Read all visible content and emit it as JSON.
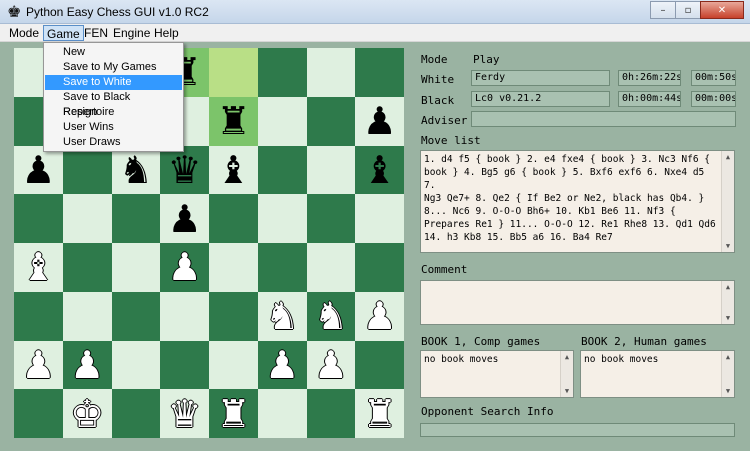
{
  "window": {
    "title": "Python Easy Chess GUI v1.0 RC2",
    "icon": "♚",
    "buttons": {
      "minimize": "–",
      "maximize": "▫",
      "close": "✕"
    }
  },
  "menu": {
    "items": [
      "Mode",
      "Game",
      "FEN",
      "Engine",
      "Help"
    ],
    "active": "Game"
  },
  "game_menu": {
    "items": [
      "New",
      "Save to My Games",
      "Save to White Repertoire",
      "Save to Black Repertoire",
      "Resign",
      "User Wins",
      "User Draws"
    ],
    "selected": "Save to White Repertoire"
  },
  "board": {
    "rows": [
      [
        "",
        "",
        "",
        "♜",
        "",
        "",
        "",
        ""
      ],
      [
        "",
        "",
        "",
        "",
        "♜",
        "",
        "",
        "♟"
      ],
      [
        "♟",
        "",
        "♞",
        "♛",
        "♝",
        "",
        "",
        "♝"
      ],
      [
        "",
        "",
        "",
        "♟",
        "",
        "",
        "",
        ""
      ],
      [
        "♗",
        "",
        "",
        "♙",
        "",
        "",
        "",
        ""
      ],
      [
        "",
        "",
        "",
        "",
        "",
        "♘",
        "♘",
        "♙"
      ],
      [
        "♙",
        "♙",
        "",
        "",
        "",
        "♙",
        "♙",
        ""
      ],
      [
        "",
        "♔",
        "",
        "♕",
        "♖",
        "",
        "",
        "♖"
      ]
    ],
    "colors": {
      "light": "#dff0e0",
      "dark": "#2e7a4b",
      "highlight_light": "#b9df86",
      "highlight_dark": "#7cc46a"
    },
    "highlighted_squares": [
      "d8",
      "e8",
      "e7"
    ]
  },
  "info": {
    "mode_label": "Mode",
    "mode_value": "Play",
    "white_label": "White",
    "white_name": "Ferdy",
    "white_time": "0h:26m:22s",
    "white_inc": "00m:50s",
    "black_label": "Black",
    "black_name": "Lc0 v0.21.2",
    "black_time": "0h:00m:44s",
    "black_inc": "00m:00s",
    "adviser_label": "Adviser",
    "adviser_value": "",
    "movelist_label": "Move list",
    "movelist_lines": [
      "1. d4 f5 { book } 2. e4 fxe4 { book } 3. Nc3 Nf6 {",
      "book } 4. Bg5 g6 { book } 5. Bxf6 exf6 6. Nxe4 d5 7.",
      "Ng3 Qe7+ 8. Qe2 { If Be2 or Ne2, black has Qb4. }",
      "8... Nc6 9. O-O-O Bh6+ 10. Kb1 Be6 11. Nf3 {",
      "Prepares Re1 } 11... O-O-O 12. Re1 Rhe8 13. Qd1 Qd6",
      "14. h3 Kb8 15. Bb5 a6 16. Ba4 Re7"
    ],
    "comment_label": "Comment",
    "comment_value": "",
    "book1_label": "BOOK 1, Comp games",
    "book1_value": "no book moves",
    "book2_label": "BOOK 2, Human games",
    "book2_value": "no book moves",
    "search_label": "Opponent Search Info",
    "search_value": ""
  },
  "scroll_arrows": {
    "up": "▲",
    "down": "▼"
  }
}
